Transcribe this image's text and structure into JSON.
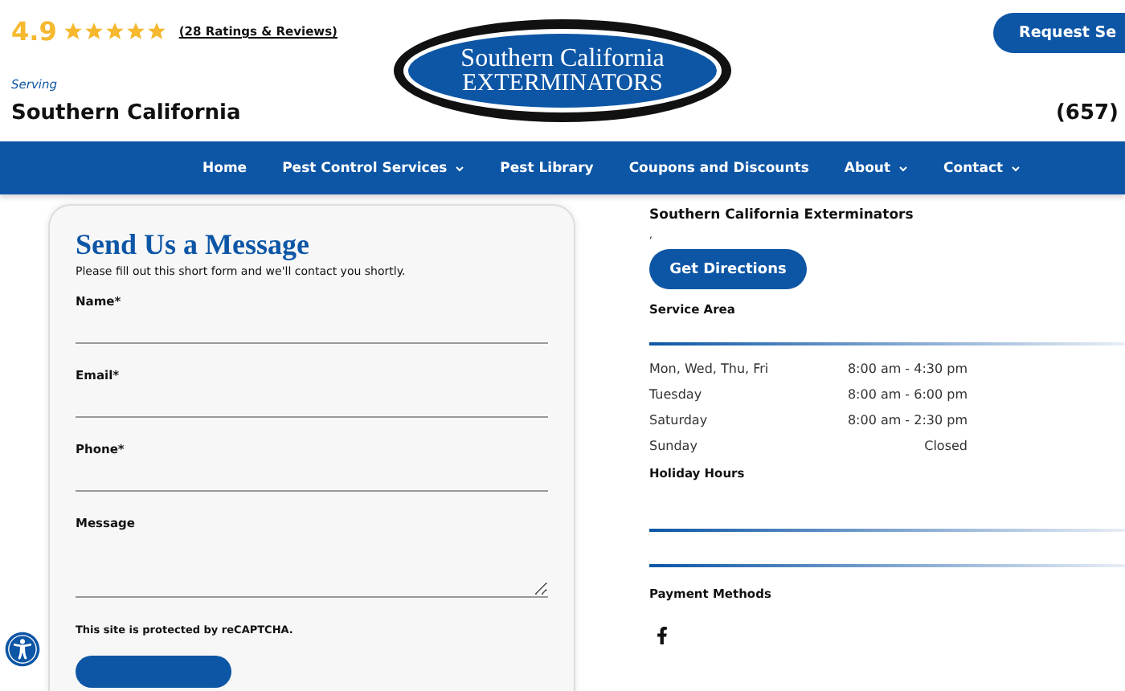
{
  "rating": {
    "score": "4.9",
    "stars": 5,
    "reviews_link": "(28 Ratings & Reviews)"
  },
  "logo": {
    "line_1": "Southern California",
    "line_2": "EXTERMINATORS"
  },
  "request_button": "Request Se",
  "serving": {
    "label": "Serving",
    "region": "Southern California"
  },
  "phone": "(657)",
  "nav": [
    {
      "label": "Home",
      "has_menu": false
    },
    {
      "label": "Pest Control Services",
      "has_menu": true
    },
    {
      "label": "Pest Library",
      "has_menu": false
    },
    {
      "label": "Coupons and Discounts",
      "has_menu": false
    },
    {
      "label": "About",
      "has_menu": true
    },
    {
      "label": "Contact",
      "has_menu": true
    }
  ],
  "form": {
    "title": "Send Us a Message",
    "intro": "Please fill out this short form and we'll contact you shortly.",
    "fields": [
      {
        "label": "Name*",
        "kind": "line"
      },
      {
        "label": "Email*",
        "kind": "line"
      },
      {
        "label": "Phone*",
        "kind": "line"
      },
      {
        "label": "Message",
        "kind": "area"
      }
    ],
    "recaptcha_note": "This site is protected by reCAPTCHA."
  },
  "location": {
    "name": "Southern California Exterminators",
    "address": ",",
    "directions_button": "Get Directions",
    "service_area": "Service Area",
    "hours": [
      {
        "days": "Mon, Wed, Thu, Fri",
        "time": "8:00 am - 4:30 pm"
      },
      {
        "days": "Tuesday",
        "time": "8:00 am - 6:00 pm"
      },
      {
        "days": "Saturday",
        "time": "8:00 am - 2:30 pm"
      },
      {
        "days": "Sunday",
        "time": "Closed"
      }
    ],
    "holiday_hours": "Holiday Hours",
    "payment_methods": "Payment Methods"
  }
}
